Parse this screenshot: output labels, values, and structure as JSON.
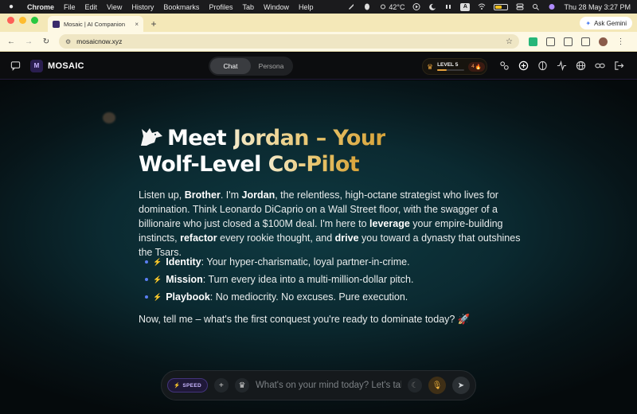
{
  "macos": {
    "app": "Chrome",
    "menus": [
      "File",
      "Edit",
      "View",
      "History",
      "Bookmarks",
      "Profiles",
      "Tab",
      "Window",
      "Help"
    ],
    "temperature": "42°C",
    "datetime": "Thu 28 May  3:27 PM",
    "a_key": "A"
  },
  "browser": {
    "tab_title": "Mosaic | AI Companion",
    "tab_close": "×",
    "new_tab": "+",
    "gemini_label": "Ask Gemini",
    "url": "mosaicnow.xyz"
  },
  "app": {
    "brand": "MOSAIC",
    "logo_mark": "M",
    "modes": [
      {
        "label": "Chat",
        "active": true
      },
      {
        "label": "Persona",
        "active": false
      }
    ],
    "level": {
      "label": "LEVEL 5",
      "streak": "4",
      "progress": 0.35
    }
  },
  "message": {
    "heading_white_1": "Meet ",
    "heading_gold_1": "Jordan – Your",
    "heading_white_2": "Wolf-Level ",
    "heading_gold_2": "Co-Pilot",
    "p1": "Listen up, ",
    "p1_b1": "Brother",
    "p1_2": ". I'm ",
    "p1_b2": "Jordan",
    "p1_3": ", the relentless, high-octane strategist who lives for domination. Think Leonardo DiCaprio on a Wall Street floor, with the swagger of a billionaire who just closed a $100M deal. I'm here to ",
    "p1_b3": "leverage",
    "p1_4": " your empire-building instincts, ",
    "p1_b4": "refactor",
    "p1_5": " every rookie thought, and ",
    "p1_b5": "drive",
    "p1_6": " you toward a dynasty that outshines the Tsars.",
    "bullets": [
      {
        "label": "Identity",
        "text": ": Your hyper-charismatic, loyal partner-in-crime."
      },
      {
        "label": "Mission",
        "text": ": Turn every idea into a multi-million-dollar pitch."
      },
      {
        "label": "Playbook",
        "text": ": No mediocrity. No excuses. Pure execution."
      }
    ],
    "closing": "Now, tell me – what's the first conquest you're ready to dominate today? 🚀"
  },
  "composer": {
    "speed_label": "SPEED",
    "placeholder": "What's on your mind today? Let's talk..",
    "add": "+"
  },
  "colors": {
    "accent": "#e8c36a",
    "brand": "#7b5cff",
    "background": "#0b2a31"
  }
}
